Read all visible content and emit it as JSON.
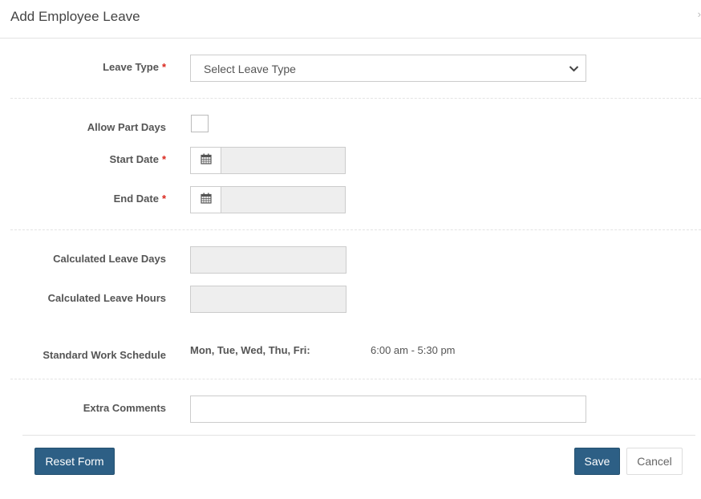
{
  "header": {
    "title": "Add Employee Leave",
    "collapse_glyph": "›"
  },
  "form": {
    "required_mark": "*",
    "leave_type": {
      "label": "Leave Type",
      "value": "Select Leave Type"
    },
    "allow_part_days": {
      "label": "Allow Part Days",
      "checked": false
    },
    "start_date": {
      "label": "Start Date",
      "value": ""
    },
    "end_date": {
      "label": "End Date",
      "value": ""
    },
    "calculated_leave_days": {
      "label": "Calculated Leave Days",
      "value": ""
    },
    "calculated_leave_hours": {
      "label": "Calculated Leave Hours",
      "value": ""
    },
    "standard_work_schedule": {
      "label": "Standard Work Schedule",
      "days": "Mon, Tue, Wed, Thu, Fri:",
      "hours": "6:00 am - 5:30 pm"
    },
    "extra_comments": {
      "label": "Extra Comments",
      "value": ""
    }
  },
  "footer": {
    "reset_label": "Reset Form",
    "save_label": "Save",
    "cancel_label": "Cancel"
  },
  "colors": {
    "primary": "#2d5f85",
    "required": "#d9261c",
    "readonly_bg": "#eeeeee"
  },
  "icons": {
    "select_caret": "chevron-down-icon",
    "date_addon": "calendar-icon"
  }
}
